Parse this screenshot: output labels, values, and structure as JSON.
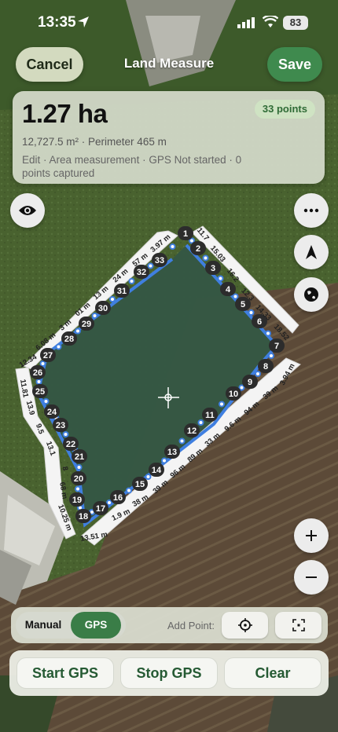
{
  "status": {
    "time": "13:35",
    "battery": "83"
  },
  "header": {
    "cancel": "Cancel",
    "title": "Land Measure",
    "save": "Save"
  },
  "summary": {
    "area": "1.27 ha",
    "points_badge": "33 points",
    "details": "12,727.5 m² · Perimeter 465 m",
    "meta": "Edit · Area measurement · GPS Not started · 0 points captured"
  },
  "map": {
    "points": [
      "1",
      "2",
      "3",
      "4",
      "5",
      "6",
      "7",
      "8",
      "9",
      "10",
      "11",
      "12",
      "13",
      "14",
      "15",
      "16",
      "17",
      "18",
      "19",
      "20",
      "21",
      "22",
      "23",
      "24",
      "25",
      "26",
      "27",
      "28",
      "29",
      "30",
      "31",
      "32",
      "33"
    ],
    "segment_labels": [
      "11.7",
      "15.03",
      "16.2",
      "12.3",
      "14.33",
      "18.52",
      "3.94 m",
      "39 m",
      "94 m",
      "9.6 m",
      "33 m",
      "89 m",
      "96 m",
      "39 m",
      "38 m",
      "1.9 m",
      "13.51 m",
      "10.25 m",
      "68 m",
      "8",
      "13.1",
      "9.5",
      "13.9",
      "11.81",
      "12.34",
      "6.08 m",
      "3 m",
      "01 m",
      "13 m",
      "24 m",
      "57 m",
      "3.97 m"
    ],
    "colors": {
      "route": "#3f7fe0",
      "point_bg": "#2c2c2c",
      "label_bg": "#f4f4f4"
    }
  },
  "controls": {
    "mode_manual": "Manual",
    "mode_gps": "GPS",
    "add_point": "Add Point:"
  },
  "actions": {
    "start": "Start GPS",
    "stop": "Stop GPS",
    "clear": "Clear"
  }
}
